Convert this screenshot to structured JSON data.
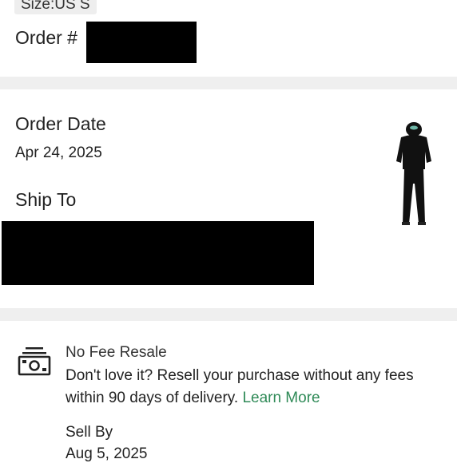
{
  "header": {
    "size_badge": "Size:US S",
    "order_label": "Order #"
  },
  "details": {
    "order_date_label": "Order Date",
    "order_date_value": "Apr 24, 2025",
    "ship_to_label": "Ship To"
  },
  "resale": {
    "title": "No Fee Resale",
    "line1": "Don't love it? Resell your purchase without any fees",
    "line2": "within 90 days of delivery.",
    "learn_more": "Learn More",
    "sell_by_label": "Sell By",
    "sell_by_date": "Aug 5, 2025"
  },
  "icons": {
    "product": "tracksuit-product-icon",
    "resale": "money-stack-icon"
  },
  "colors": {
    "link": "#2f8a57",
    "divider": "#efefef"
  }
}
